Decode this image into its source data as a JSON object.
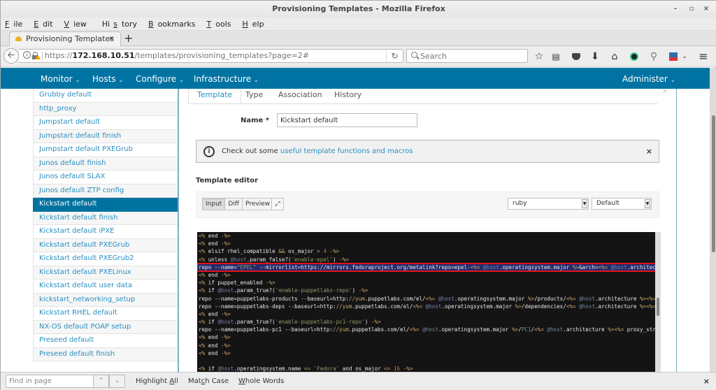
{
  "window": {
    "title": "Provisioning Templates - Mozilla Firefox",
    "controls": {
      "minimize": "-",
      "maximize": "▫",
      "close": "×"
    }
  },
  "menubar": [
    {
      "label": "File",
      "accel": "F",
      "rest": "ile"
    },
    {
      "label": "Edit",
      "accel": "E",
      "rest": "dit"
    },
    {
      "label": "View",
      "accel": "V",
      "rest": "iew"
    },
    {
      "label": "History",
      "pre": "Hi",
      "accel": "s",
      "rest": "tory"
    },
    {
      "label": "Bookmarks",
      "accel": "B",
      "rest": "ookmarks"
    },
    {
      "label": "Tools",
      "accel": "T",
      "rest": "ools"
    },
    {
      "label": "Help",
      "accel": "H",
      "rest": "elp"
    }
  ],
  "browser_tab": {
    "label": "Provisioning Templates",
    "close": "×",
    "new_tab": "+"
  },
  "navbar": {
    "url_prefix": "https://",
    "url_host": "172.168.10.51",
    "url_path": "/templates/provisioning_templates?page=2#",
    "reload": "↻",
    "search_placeholder": "Search",
    "icons": [
      "star-icon",
      "reading-list-icon",
      "pocket-icon",
      "download-icon",
      "home-icon",
      "extension-icon",
      "addon-icon",
      "screenshot-icon",
      "menu-icon"
    ]
  },
  "app_nav": {
    "items": [
      {
        "label": "Monitor"
      },
      {
        "label": "Hosts"
      },
      {
        "label": "Configure"
      },
      {
        "label": "Infrastructure"
      }
    ],
    "right": {
      "label": "Administer"
    },
    "chevron": "⌄",
    "color": "#0073a3"
  },
  "sidebar": {
    "items": [
      {
        "label": "Grubby default"
      },
      {
        "label": "http_proxy"
      },
      {
        "label": "Jumpstart default"
      },
      {
        "label": "Jumpstart default finish"
      },
      {
        "label": "Jumpstart default PXEGrub"
      },
      {
        "label": "Junos default finish"
      },
      {
        "label": "Junos default SLAX"
      },
      {
        "label": "Junos default ZTP config"
      },
      {
        "label": "Kickstart default",
        "active": true
      },
      {
        "label": "Kickstart default finish"
      },
      {
        "label": "Kickstart default iPXE"
      },
      {
        "label": "Kickstart default PXEGrub"
      },
      {
        "label": "Kickstart default PXEGrub2"
      },
      {
        "label": "Kickstart default PXELinux"
      },
      {
        "label": "Kickstart default user data"
      },
      {
        "label": "kickstart_networking_setup"
      },
      {
        "label": "Kickstart RHEL default"
      },
      {
        "label": "NX-OS default POAP setup"
      },
      {
        "label": "Preseed default"
      },
      {
        "label": "Preseed default finish"
      }
    ]
  },
  "form": {
    "tabs": [
      {
        "label": "Template",
        "active": true
      },
      {
        "label": "Type"
      },
      {
        "label": "Association"
      },
      {
        "label": "History"
      }
    ],
    "panel_close": "×",
    "name_label": "Name *",
    "name_value": "Kickstart default",
    "alert": {
      "prefix": "Check out some ",
      "link": "useful template functions and macros",
      "close": "×"
    },
    "template_editor_label": "Template editor",
    "editor_modes": [
      {
        "label": "Input",
        "active": true
      },
      {
        "label": "Diff"
      },
      {
        "label": "Preview"
      }
    ],
    "expand_icon": "⤢",
    "language_select": "ruby",
    "theme_select": "Default"
  },
  "editor": {
    "lines": [
      {
        "html": "<span class='k'>&lt;%</span> end <span class='k'>-%&gt;</span>"
      },
      {
        "html": "<span class='k'>&lt;%</span> end <span class='k'>-%&gt;</span>"
      },
      {
        "html": "<span class='k'>&lt;%</span> elsif rhel_compatible <span class='k'>&amp;&amp;</span> os_major <span class='k'>&gt;</span> <span class='n'>4</span> <span class='k'>-%&gt;</span>"
      },
      {
        "html": "<span class='k'>&lt;%</span> unless <span class='v'>@host</span>.param_false?(<span class='s'>'enable-epel'</span>) <span class='k'>-%&gt;</span>"
      },
      {
        "html": "repo --name=<span class='s'>\"EPEL\"</span> --mirrorlist=https://mirrors.fedoraproject.org/metalink?repo=epel-<span class='k'>&lt;%=</span> <span class='v'>@host</span>.operatingsystem.major <span class='k'>%&gt;</span>&amp;arch=<span class='k'>&lt;%=</span> <span class='v'>@host</span>.architecture",
        "selected": true
      },
      {
        "html": "<span class='k'>&lt;%</span> end <span class='k'>-%&gt;</span>"
      },
      {
        "html": "<span class='k'>&lt;%</span> if puppet_enabled <span class='k'>-%&gt;</span>"
      },
      {
        "html": "<span class='k'>&lt;%</span> if <span class='v'>@host</span>.param_true?(<span class='s'>'enable-puppetlabs-repo'</span>) <span class='k'>-%&gt;</span>"
      },
      {
        "html": "repo --name=puppetlabs-products --baseurl=http:<span class='k'>//yum</span>.puppetlabs.com/el/<span class='k'>&lt;%=</span> <span class='v'>@host</span>.operatingsystem.major <span class='k'>%&gt;</span>/products/<span class='k'>&lt;%=</span> <span class='v'>@host</span>.architecture <span class='k'>%&gt;&lt;%=</span>"
      },
      {
        "html": "repo --name=puppetlabs-deps --baseurl=http:<span class='k'>//yum</span>.puppetlabs.com/el/<span class='k'>&lt;%=</span> <span class='v'>@host</span>.operatingsystem.major <span class='k'>%&gt;</span>/dependencies/<span class='k'>&lt;%=</span> <span class='v'>@host</span>.architecture <span class='k'>%&gt;&lt;%=</span>"
      },
      {
        "html": "<span class='k'>&lt;%</span> end <span class='k'>-%&gt;</span>"
      },
      {
        "html": "<span class='k'>&lt;%</span> if <span class='v'>@host</span>.param_true?(<span class='s'>'enable-puppetlabs-pc1-repo'</span>) <span class='k'>-%&gt;</span>"
      },
      {
        "html": "repo --name=puppetlabs-pc1 --baseurl=http:<span class='k'>//yum</span>.puppetlabs.com/el/<span class='k'>&lt;%=</span> <span class='v'>@host</span>.operatingsystem.major <span class='k'>%&gt;</span>/<span class='v'>PC1</span>/<span class='k'>&lt;%=</span> <span class='v'>@host</span>.architecture <span class='k'>%&gt;&lt;%=</span> proxy_string"
      },
      {
        "html": "<span class='k'>&lt;%</span> end <span class='k'>-%&gt;</span>"
      },
      {
        "html": "<span class='k'>&lt;%</span> end <span class='k'>-%&gt;</span>"
      },
      {
        "html": "<span class='k'>&lt;%</span> end <span class='k'>-%&gt;</span>"
      },
      {
        "html": ""
      },
      {
        "html": "<span class='k'>&lt;%</span> if <span class='v'>@host</span>.operatingsystem.name <span class='k'>==</span> <span class='s'>'Fedora'</span> and os_major <span class='k'>&lt;=</span> <span class='n'>16</span> <span class='k'>-%&gt;</span>"
      }
    ]
  },
  "findbar": {
    "placeholder": "Find in page",
    "prev": "⌃",
    "next": "⌄",
    "options": [
      {
        "pre": "Highlight ",
        "accel": "A",
        "rest": "ll"
      },
      {
        "pre": "Mat",
        "accel": "c",
        "rest": "h Case"
      },
      {
        "pre": "",
        "accel": "W",
        "rest": "hole Words"
      }
    ],
    "close": "×"
  }
}
